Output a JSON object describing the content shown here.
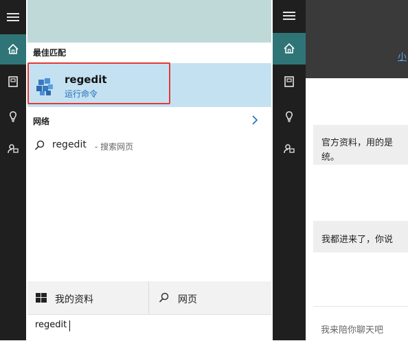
{
  "search": {
    "best_match_header": "最佳匹配",
    "best_match": {
      "name": "regedit",
      "type": "运行命令"
    },
    "web_header": "网络",
    "web_result": {
      "query": "regedit",
      "suffix": " - 搜索网页"
    },
    "bottom_tabs": {
      "my_stuff": "我的资料",
      "web": "网页"
    },
    "query_text": "regedit"
  },
  "cortana": {
    "link": "小",
    "messages": [
      "官方资料，用的是",
      "统。",
      "我都进来了，你说",
      "我来陪你聊天吧"
    ]
  },
  "colors": {
    "sidebar": "#1f1f1f",
    "accent": "#2f7578",
    "selected_result": "#c4e1f2",
    "highlight_border": "#e53935"
  },
  "icons": [
    "hamburger-icon",
    "home-icon",
    "notebook-icon",
    "idea-icon",
    "feedback-icon",
    "chevron-right-icon",
    "search-icon",
    "windows-icon"
  ]
}
